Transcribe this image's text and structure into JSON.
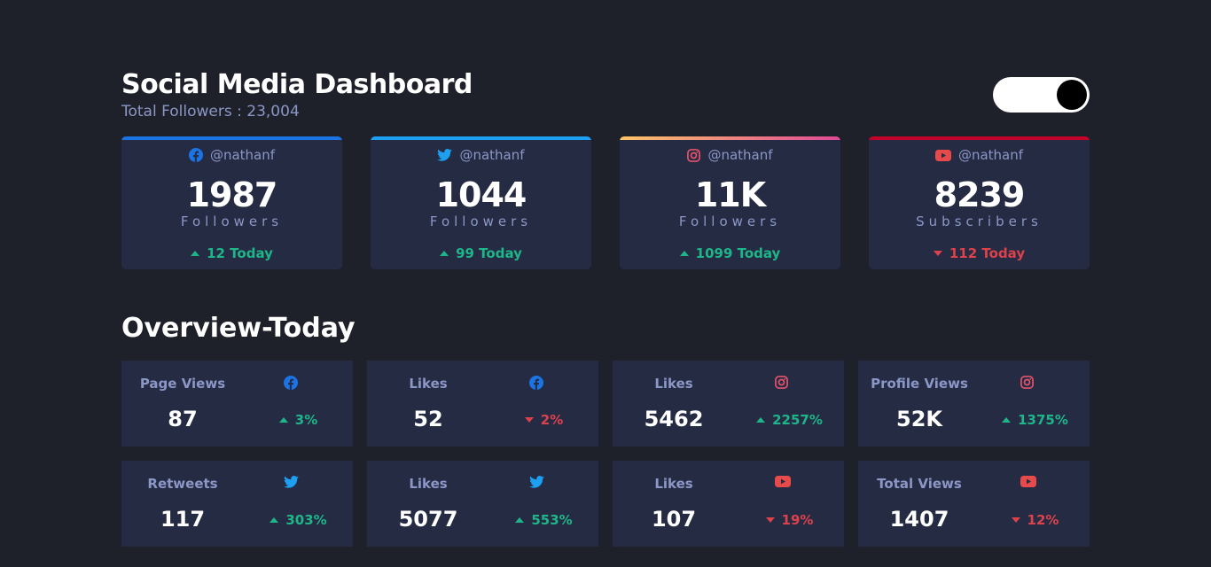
{
  "header": {
    "title": "Social Media Dashboard",
    "total_followers": "Total Followers : 23,004"
  },
  "theme_toggle": {
    "state": "dark"
  },
  "colors": {
    "background": "#1e202a",
    "card": "#252b43",
    "muted_text": "#8b97c6",
    "up": "#1eb589",
    "down": "#dc414c",
    "facebook": "#1b74e4",
    "twitter": "#1da0f2",
    "instagram": "#e4546c",
    "youtube": "#c4032a"
  },
  "cards": [
    {
      "platform": "facebook",
      "icon": "facebook-icon",
      "handle": "@nathanf",
      "count": "1987",
      "unit": "Followers",
      "change": "12 Today",
      "direction": "up"
    },
    {
      "platform": "twitter",
      "icon": "twitter-icon",
      "handle": "@nathanf",
      "count": "1044",
      "unit": "Followers",
      "change": "99 Today",
      "direction": "up"
    },
    {
      "platform": "instagram",
      "icon": "instagram-icon",
      "handle": "@nathanf",
      "count": "11K",
      "unit": "Followers",
      "change": "1099 Today",
      "direction": "up"
    },
    {
      "platform": "youtube",
      "icon": "youtube-icon",
      "handle": "@nathanf",
      "count": "8239",
      "unit": "Subscribers",
      "change": "112 Today",
      "direction": "down"
    }
  ],
  "overview": {
    "title": "Overview-Today",
    "tiles": [
      {
        "label": "Page Views",
        "icon": "facebook-icon",
        "value": "87",
        "change": "3%",
        "direction": "up"
      },
      {
        "label": "Likes",
        "icon": "facebook-icon",
        "value": "52",
        "change": "2%",
        "direction": "down"
      },
      {
        "label": "Likes",
        "icon": "instagram-icon",
        "value": "5462",
        "change": "2257%",
        "direction": "up"
      },
      {
        "label": "Profile Views",
        "icon": "instagram-icon",
        "value": "52K",
        "change": "1375%",
        "direction": "up"
      },
      {
        "label": "Retweets",
        "icon": "twitter-icon",
        "value": "117",
        "change": "303%",
        "direction": "up"
      },
      {
        "label": "Likes",
        "icon": "twitter-icon",
        "value": "5077",
        "change": "553%",
        "direction": "up"
      },
      {
        "label": "Likes",
        "icon": "youtube-icon",
        "value": "107",
        "change": "19%",
        "direction": "down"
      },
      {
        "label": "Total Views",
        "icon": "youtube-icon",
        "value": "1407",
        "change": "12%",
        "direction": "down"
      }
    ]
  }
}
